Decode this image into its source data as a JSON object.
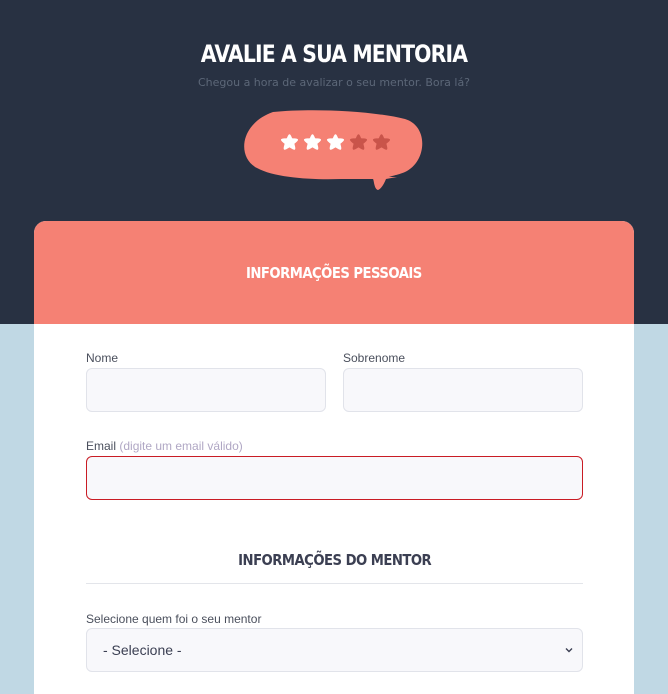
{
  "hero": {
    "title": "AVALIE A SUA MENTORIA",
    "subtitle": "Chegou a hora de avalizar o seu mentor. Bora lá?",
    "rating": {
      "value": 3,
      "max": 5
    }
  },
  "personal": {
    "title": "INFORMAÇÕES PESSOAIS",
    "first_name": {
      "label": "Nome",
      "value": ""
    },
    "last_name": {
      "label": "Sobrenome",
      "value": ""
    },
    "email": {
      "label": "Email",
      "hint": "(digite um email válido)",
      "value": ""
    }
  },
  "mentor": {
    "title": "INFORMAÇÕES DO MENTOR",
    "select_label": "Selecione quem foi o seu mentor",
    "select_value": "- Selecione -"
  },
  "colors": {
    "header_bg": "#283142",
    "page_bg": "#c0d8e4",
    "accent": "#f58174",
    "star_active": "#ffffff",
    "star_inactive": "#c9544a",
    "invalid_border": "#c91c24"
  },
  "icons": {
    "bubble": "speech-bubble-icon",
    "star": "star-icon",
    "select_arrow": "chevron-down-icon"
  }
}
